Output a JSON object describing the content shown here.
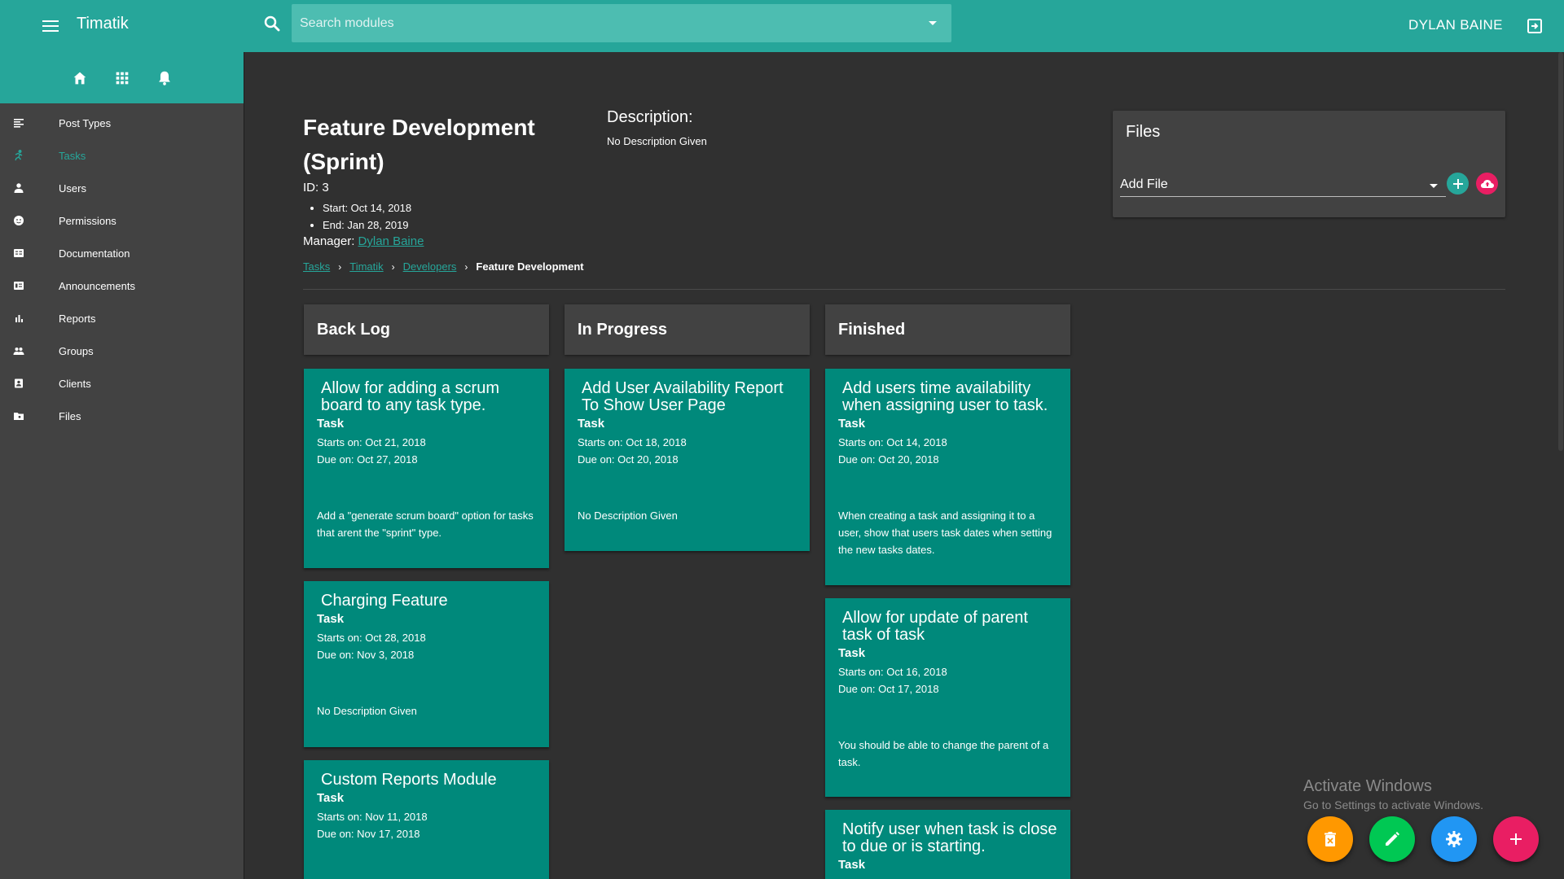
{
  "app": {
    "title": "Timatik",
    "user_name": "DYLAN BAINE"
  },
  "search": {
    "placeholder": "Search modules",
    "value": ""
  },
  "sidebar": {
    "top_icons": [
      "home-icon",
      "apps-grid-icon",
      "bell-icon"
    ],
    "items": [
      {
        "label": "Post Types",
        "icon": "list-icon",
        "active": false
      },
      {
        "label": "Tasks",
        "icon": "running-icon",
        "active": true
      },
      {
        "label": "Users",
        "icon": "person-icon",
        "active": false
      },
      {
        "label": "Permissions",
        "icon": "face-icon",
        "active": false
      },
      {
        "label": "Documentation",
        "icon": "document-icon",
        "active": false
      },
      {
        "label": "Announcements",
        "icon": "announcement-icon",
        "active": false
      },
      {
        "label": "Reports",
        "icon": "bar-chart-icon",
        "active": false
      },
      {
        "label": "Groups",
        "icon": "group-icon",
        "active": false
      },
      {
        "label": "Clients",
        "icon": "contact-icon",
        "active": false
      },
      {
        "label": "Files",
        "icon": "folder-icon",
        "active": false
      }
    ]
  },
  "project": {
    "title": "Feature Development (Sprint)",
    "id_text": "ID: 3",
    "start_text": "Start: Oct 14, 2018",
    "end_text": "End: Jan 28, 2019",
    "manager_label": "Manager:",
    "manager_name": "Dylan Baine",
    "description_heading": "Description:",
    "description_text": "No Description Given"
  },
  "breadcrumb": {
    "items": [
      "Tasks",
      "Timatik",
      "Developers"
    ],
    "current": "Feature Development"
  },
  "files": {
    "title": "Files",
    "select_label": "Add File"
  },
  "columns": [
    {
      "title": "Back Log"
    },
    {
      "title": "In Progress"
    },
    {
      "title": "Finished"
    }
  ],
  "cards": {
    "backlog": [
      {
        "title": "Allow for adding a scrum board to any task type.",
        "type": "Task",
        "starts": "Starts on: Oct 21, 2018",
        "due": "Due on: Oct 27, 2018",
        "description": "Add a \"generate scrum board\" option for tasks that arent the \"sprint\" type."
      },
      {
        "title": "Charging Feature",
        "type": "Task",
        "starts": "Starts on: Oct 28, 2018",
        "due": "Due on: Nov 3, 2018",
        "description": "No Description Given"
      },
      {
        "title": "Custom Reports Module",
        "type": "Task",
        "starts": "Starts on: Nov 11, 2018",
        "due": "Due on: Nov 17, 2018",
        "description": ""
      }
    ],
    "in_progress": [
      {
        "title": "Add User Availability Report To Show User Page",
        "type": "Task",
        "starts": "Starts on: Oct 18, 2018",
        "due": "Due on: Oct 20, 2018",
        "description": "No Description Given"
      }
    ],
    "finished": [
      {
        "title": "Add users time availability when assigning user to task.",
        "type": "Task",
        "starts": "Starts on: Oct 14, 2018",
        "due": "Due on: Oct 20, 2018",
        "description": "When creating a task and assigning it to a user, show that users task dates when setting the new tasks dates."
      },
      {
        "title": "Allow for update of parent task of task",
        "type": "Task",
        "starts": "Starts on: Oct 16, 2018",
        "due": "Due on: Oct 17, 2018",
        "description": "You should be able to change the parent of a task."
      },
      {
        "title": "Notify user when task is close to due or is starting.",
        "type": "Task",
        "starts": "",
        "due": "",
        "description": ""
      }
    ]
  },
  "watermark": {
    "line1": "Activate Windows",
    "line2": "Go to Settings to activate Windows."
  },
  "fabs": [
    {
      "name": "delete-button",
      "icon": "trash-icon",
      "color": "#ff9800"
    },
    {
      "name": "edit-button",
      "icon": "pencil-icon",
      "color": "#00c853"
    },
    {
      "name": "settings-button",
      "icon": "gear-icon",
      "color": "#2196f3"
    },
    {
      "name": "add-button",
      "icon": "plus-icon",
      "color": "#e91e63"
    }
  ],
  "colors": {
    "primary": "#26a69a",
    "card": "#00897b",
    "background": "#303030",
    "panel": "#424242",
    "accent": "#e91e63"
  }
}
